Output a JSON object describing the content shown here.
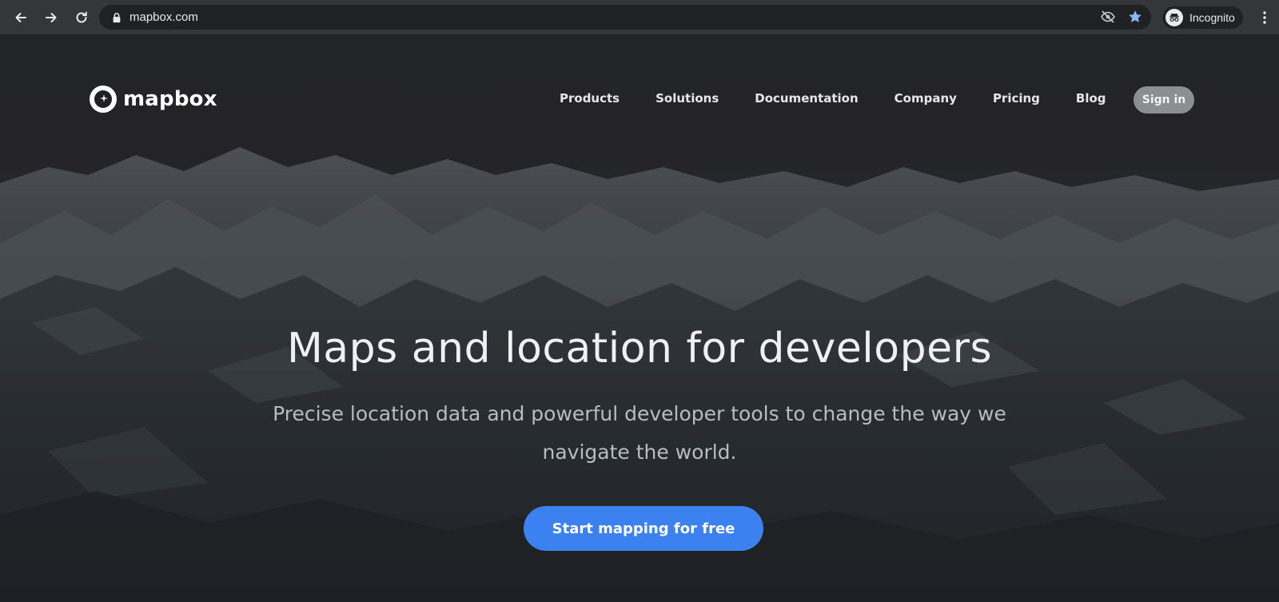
{
  "browser": {
    "url": "mapbox.com",
    "incognito_label": "Incognito",
    "icons": {
      "back": "arrow-left-icon",
      "forward": "arrow-right-icon",
      "reload": "reload-icon",
      "lock": "lock-icon",
      "tracking": "eye-slash-icon",
      "bookmark": "star-icon",
      "incognito": "incognito-icon",
      "menu": "kebab-menu-icon"
    },
    "colors": {
      "bookmark_star": "#8ab4f8"
    }
  },
  "site": {
    "logo_text": "mapbox",
    "nav": [
      {
        "label": "Products"
      },
      {
        "label": "Solutions"
      },
      {
        "label": "Documentation"
      },
      {
        "label": "Company"
      },
      {
        "label": "Pricing"
      },
      {
        "label": "Blog"
      }
    ],
    "signin_label": "Sign in"
  },
  "hero": {
    "title": "Maps and location for developers",
    "subtitle": "Precise location data and powerful developer tools to change the way we navigate the world.",
    "cta_label": "Start mapping for free"
  },
  "colors": {
    "cta": "#3b82f0",
    "signin_bg": "#8c8e91"
  }
}
